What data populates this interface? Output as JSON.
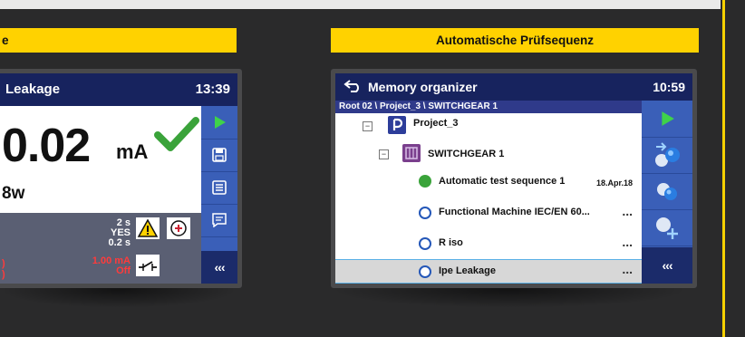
{
  "left_panel": {
    "header_text": "e",
    "screen": {
      "title": "Leakage",
      "time": "13:39",
      "main_value": "0.02",
      "main_unit": "mA",
      "power_value": "8w",
      "params": [
        "2 s",
        "YES",
        "0.2 s"
      ],
      "limit_value": "1.00 mA",
      "limit_state": "Off",
      "left_red_marks": [
        ")",
        ")"
      ],
      "more_label": "‹‹‹"
    }
  },
  "right_panel": {
    "header_text": "Automatische Prüfsequenz",
    "screen": {
      "title": "Memory organizer",
      "time": "10:59",
      "path": "Root 02 \\ Project_3 \\ SWITCHGEAR 1",
      "items": [
        {
          "label": "Project_3",
          "expander": "−"
        },
        {
          "label": "SWITCHGEAR 1",
          "expander": "−"
        },
        {
          "label": "Automatic test sequence 1",
          "date": "18.Apr.18",
          "status": "passed"
        },
        {
          "label": "Functional Machine IEC/EN 60...",
          "more": "..."
        },
        {
          "label": "R iso",
          "more": "..."
        },
        {
          "label": "Ipe Leakage",
          "more": "..."
        }
      ],
      "more_label": "‹‹‹"
    }
  },
  "colors": {
    "accent_yellow": "#ffd200",
    "header_navy": "#17235e",
    "sidebar_blue": "#3a5fb8",
    "pass_green": "#3aa33a"
  }
}
